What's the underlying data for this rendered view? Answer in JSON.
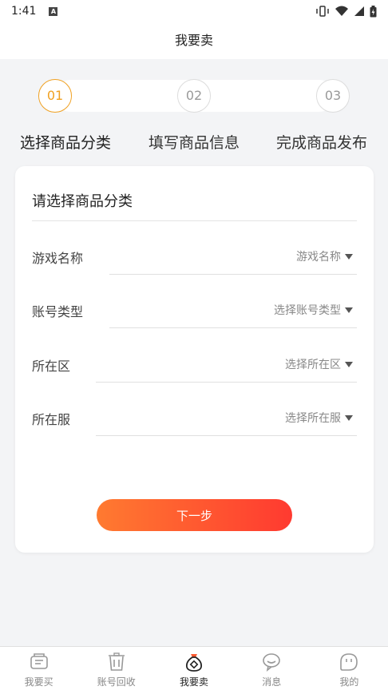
{
  "status": {
    "time": "1:41",
    "a_badge": "A"
  },
  "header": {
    "title": "我要卖"
  },
  "steps": [
    {
      "num": "01",
      "label": "选择商品分类",
      "active": true
    },
    {
      "num": "02",
      "label": "填写商品信息",
      "active": false
    },
    {
      "num": "03",
      "label": "完成商品发布",
      "active": false
    }
  ],
  "form": {
    "title": "请选择商品分类",
    "rows": [
      {
        "label": "游戏名称",
        "placeholder": "游戏名称"
      },
      {
        "label": "账号类型",
        "placeholder": "选择账号类型"
      },
      {
        "label": "所在区",
        "placeholder": "选择所在区"
      },
      {
        "label": "所在服",
        "placeholder": "选择所在服"
      }
    ],
    "next_label": "下一步"
  },
  "tabbar": [
    {
      "label": "我要买",
      "icon": "ticket-icon",
      "active": false
    },
    {
      "label": "账号回收",
      "icon": "trash-icon",
      "active": false
    },
    {
      "label": "我要卖",
      "icon": "money-bag-icon",
      "active": true
    },
    {
      "label": "消息",
      "icon": "chat-bubble-icon",
      "active": false
    },
    {
      "label": "我的",
      "icon": "smile-face-icon",
      "active": false
    }
  ],
  "colors": {
    "accent": "#f0a020",
    "button_start": "#ff7a30",
    "button_end": "#ff3a30"
  }
}
